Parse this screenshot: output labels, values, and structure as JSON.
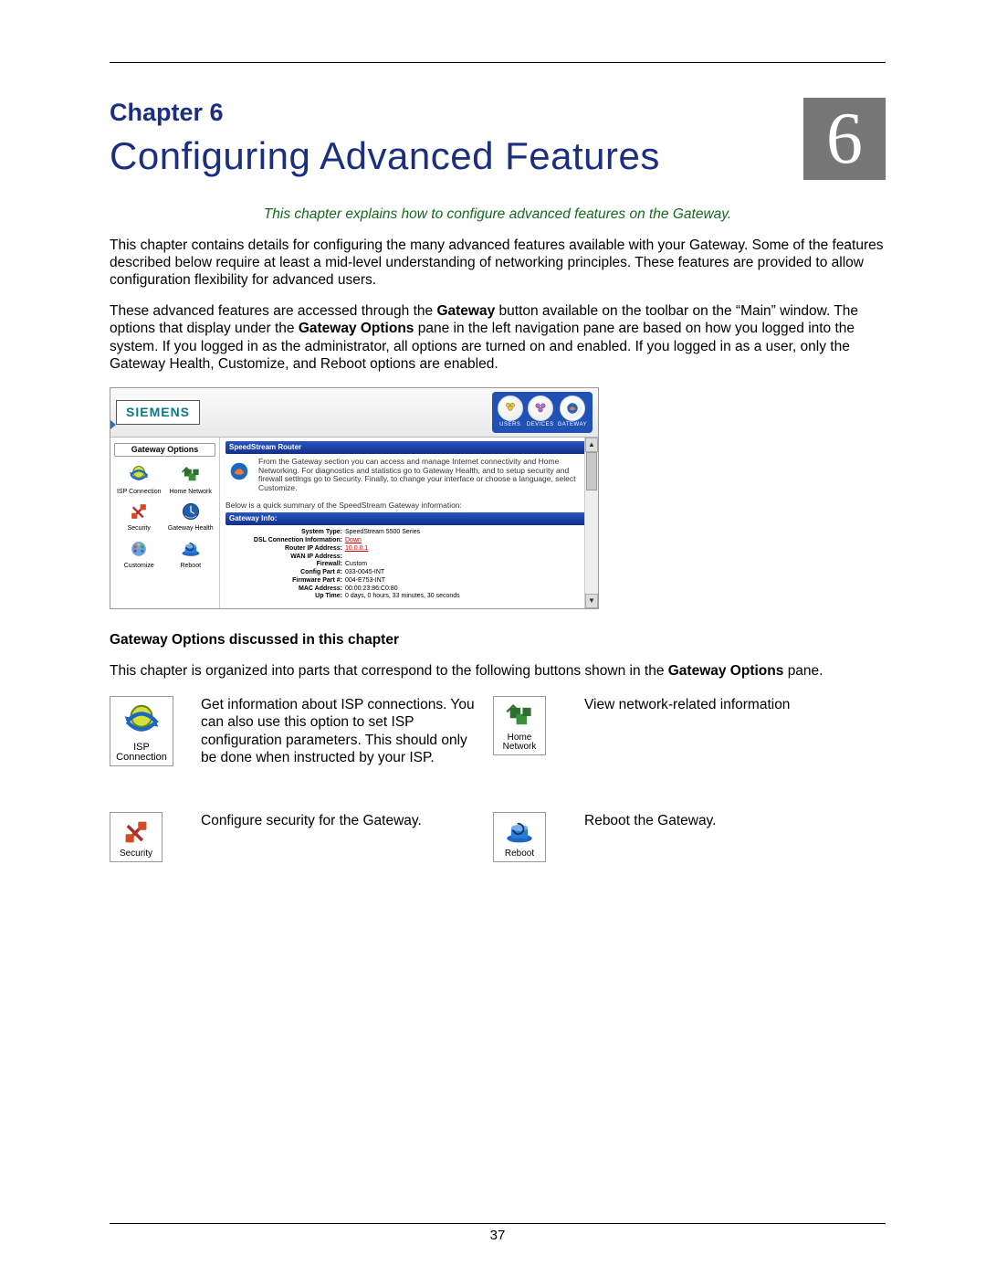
{
  "chapter": {
    "label": "Chapter 6",
    "title": "Configuring Advanced Features",
    "badge": "6",
    "tagline": "This chapter explains how to configure advanced features on the Gateway."
  },
  "paragraphs": {
    "p1": "This chapter contains details for configuring the many advanced features available with your Gateway. Some of the features described below require at least a mid-level understanding of networking principles. These features are provided to allow configuration flexibility for advanced users.",
    "p2a": "These advanced features are accessed through the ",
    "p2b_bold": "Gateway",
    "p2c": " button available on the toolbar on the “Main” window. The options that display under the ",
    "p2d_bold": "Gateway Options",
    "p2e": " pane in the left navigation pane are based on how you logged into the system. If you logged in as the administrator, all options are turned on and enabled. If you logged in as a user, only the Gateway Health, Customize, and Reboot options are enabled."
  },
  "screenshot": {
    "brand": "SIEMENS",
    "toolbar": {
      "users": "USERS",
      "devices": "DEVICES",
      "gateway": "GATEWAY"
    },
    "side_title": "Gateway Options",
    "side_items": [
      {
        "label": "ISP Connection",
        "icon": "isp"
      },
      {
        "label": "Home Network",
        "icon": "home"
      },
      {
        "label": "Security",
        "icon": "security"
      },
      {
        "label": "Gateway Health",
        "icon": "health"
      },
      {
        "label": "Customize",
        "icon": "customize"
      },
      {
        "label": "Reboot",
        "icon": "reboot"
      }
    ],
    "bar1": "SpeedStream Router",
    "lead": "From the Gateway section you can access and manage Internet connectivity and Home Networking. For diagnostics and statistics go to Gateway Health, and to setup security and firewall settings go to Security. Finally, to change your interface or choose a language, select Customize.",
    "quick": "Below is a quick summary of the SpeedStream Gateway information:",
    "bar2": "Gateway Info:",
    "info": {
      "system_type_k": "System Type:",
      "system_type_v": "SpeedStream 5500 Series",
      "dsl_k": "DSL Connection Information:",
      "dsl_v": "Down",
      "router_ip_k": "Router IP Address:",
      "router_ip_v": "10.0.0.1",
      "wan_ip_k": "WAN IP Address:",
      "wan_ip_v": "",
      "firewall_k": "Firewall:",
      "firewall_v": "Custom",
      "config_k": "Config Part #:",
      "config_v": "033-0045-INT",
      "firmware_k": "Firmware Part #:",
      "firmware_v": "004-E753-INT",
      "mac_k": "MAC Address:",
      "mac_v": "00:00:23:86:C0:80",
      "uptime_k": "Up Time:",
      "uptime_v": "0 days, 0 hours, 33 minutes, 30 seconds"
    }
  },
  "sections": {
    "subhead": "Gateway Options discussed in this chapter",
    "intro_a": "This chapter is organized into parts that correspond to the following buttons shown in the ",
    "intro_b_bold": "Gateway Options",
    "intro_c": " pane."
  },
  "cards": {
    "isp": {
      "label": "ISP Connection",
      "text": "Get information about ISP connections. You can also use this option to set ISP configuration parameters. This should only be done when instructed by your ISP."
    },
    "home": {
      "label": "Home Network",
      "text": "View network-related information"
    },
    "security": {
      "label": "Security",
      "text": "Configure security for the Gateway."
    },
    "reboot": {
      "label": "Reboot",
      "text": "Reboot the Gateway."
    }
  },
  "pageNumber": "37"
}
